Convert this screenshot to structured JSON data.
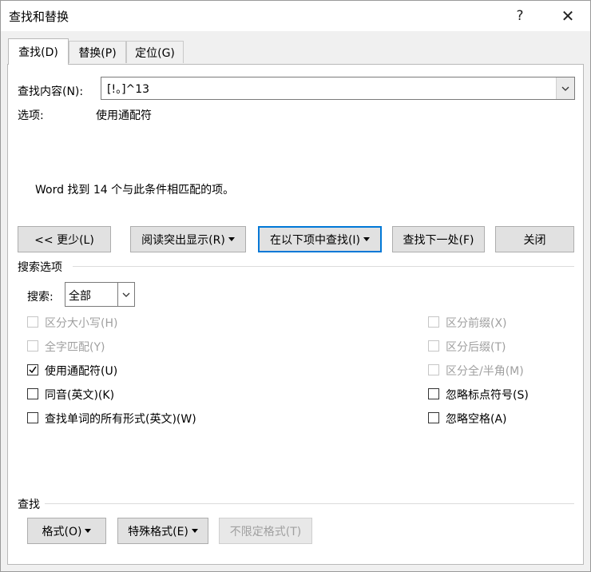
{
  "window": {
    "title": "查找和替换",
    "help": "?",
    "close": "✕"
  },
  "tabs": [
    {
      "label": "查找(D)"
    },
    {
      "label": "替换(P)"
    },
    {
      "label": "定位(G)"
    }
  ],
  "find": {
    "label": "查找内容(N):",
    "value": "[!。]^13"
  },
  "options": {
    "label": "选项:",
    "value": "使用通配符"
  },
  "result": "Word 找到 14 个与此条件相匹配的项。",
  "buttons": {
    "less": "<< 更少(L)",
    "reading_highlight": "阅读突出显示(R)",
    "find_in": "在以下项中查找(I)",
    "find_next": "查找下一处(F)",
    "close": "关闭"
  },
  "search_options": {
    "section_title": "搜索选项",
    "search_label": "搜索:",
    "search_value": "全部",
    "left": [
      {
        "label": "区分大小写(H)",
        "checked": false,
        "disabled": true
      },
      {
        "label": "全字匹配(Y)",
        "checked": false,
        "disabled": true
      },
      {
        "label": "使用通配符(U)",
        "checked": true,
        "disabled": false
      },
      {
        "label": "同音(英文)(K)",
        "checked": false,
        "disabled": false
      },
      {
        "label": "查找单词的所有形式(英文)(W)",
        "checked": false,
        "disabled": false
      }
    ],
    "right": [
      {
        "label": "区分前缀(X)",
        "checked": false,
        "disabled": true
      },
      {
        "label": "区分后缀(T)",
        "checked": false,
        "disabled": true
      },
      {
        "label": "区分全/半角(M)",
        "checked": false,
        "disabled": true
      },
      {
        "label": "忽略标点符号(S)",
        "checked": false,
        "disabled": false
      },
      {
        "label": "忽略空格(A)",
        "checked": false,
        "disabled": false
      }
    ]
  },
  "find_section": {
    "title": "查找",
    "format": "格式(O)",
    "special": "特殊格式(E)",
    "no_format": "不限定格式(T)"
  }
}
